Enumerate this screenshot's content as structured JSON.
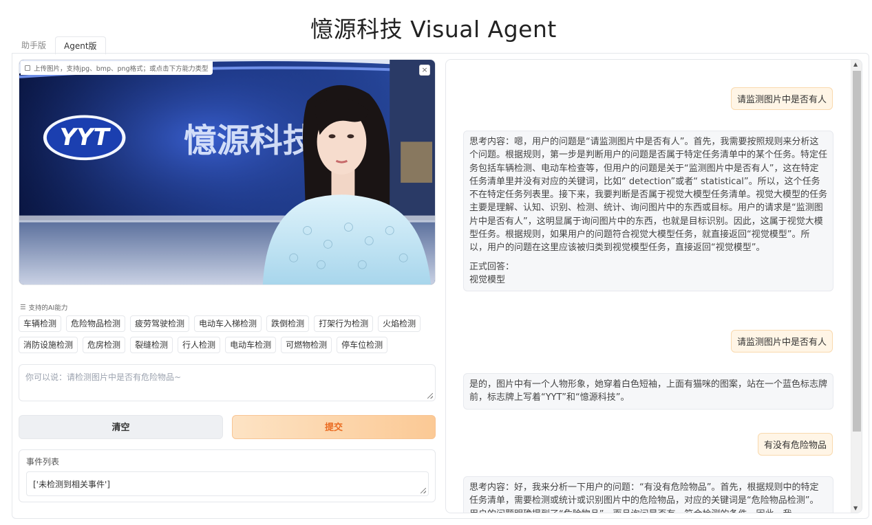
{
  "title": "憶源科技 Visual Agent",
  "tabs": [
    {
      "label": "助手版",
      "active": false
    },
    {
      "label": "Agent版",
      "active": true
    }
  ],
  "image_upload": {
    "label": "上传图片，支持jpg、bmp、png格式；或点击下方能力类型",
    "close_glyph": "×",
    "sign_logo_text": "YYT",
    "sign_company_text": "憶源科技"
  },
  "capabilities": {
    "label": "支持的AI能力",
    "items": [
      "车辆检测",
      "危险物品检测",
      "疲劳驾驶检测",
      "电动车入梯检测",
      "跌倒检测",
      "打架行为检测",
      "火焰检测",
      "消防设施检测",
      "危房检测",
      "裂缝检测",
      "行人检测",
      "电动车检测",
      "可燃物检测",
      "停车位检测"
    ]
  },
  "input": {
    "placeholder": "你可以说：请检测图片中是否有危险物品~"
  },
  "buttons": {
    "clear": "清空",
    "submit": "提交"
  },
  "events": {
    "label": "事件列表",
    "value": "['未检测到相关事件']"
  },
  "chat": {
    "messages": [
      {
        "role": "user",
        "text": "请监测图片中是否有人"
      },
      {
        "role": "bot",
        "thinking": "思考内容：嗯，用户的问题是“请监测图片中是否有人”。首先，我需要按照规则来分析这个问题。根据规则，第一步是判断用户的问题是否属于特定任务清单中的某个任务。特定任务包括车辆检测、电动车检查等，但用户的问题是关于“监测图片中是否有人”，这在特定任务清单里并没有对应的关键词，比如“ detection”或者“ statistical”。所以，这个任务不在特定任务列表里。接下来，我要判断是否属于视觉大模型任务清单。视觉大模型的任务主要是理解、认知、识别、检测、统计、询问图片中的东西或目标。用户的请求是“监测图片中是否有人”，这明显属于询问图片中的东西，也就是目标识别。因此，这属于视觉大模型任务。根据规则，如果用户的问题符合视觉大模型任务，就直接返回“视觉模型”。所以，用户的问题在这里应该被归类到视觉模型任务，直接返回“视觉模型”。",
        "answer_label": "正式回答：",
        "answer": "视觉模型"
      },
      {
        "role": "user",
        "text": "请监测图片中是否有人"
      },
      {
        "role": "bot",
        "text": "是的，图片中有一个人物形象，她穿着白色短袖，上面有猫咪的图案，站在一个蓝色标志牌前，标志牌上写着“YYT”和“憶源科技”。"
      },
      {
        "role": "user",
        "text": "有没有危险物品"
      },
      {
        "role": "bot",
        "thinking": "思考内容：好，我来分析一下用户的问题：“有没有危险物品”。首先，根据规则中的特定任务清单，需要检测或统计或识别图片中的危险物品，对应的关键词是“危险物品检测”。用户的问题明确提到了“危险物品”，而且询问是否有，符合检测的条件，因此，我"
      }
    ]
  }
}
